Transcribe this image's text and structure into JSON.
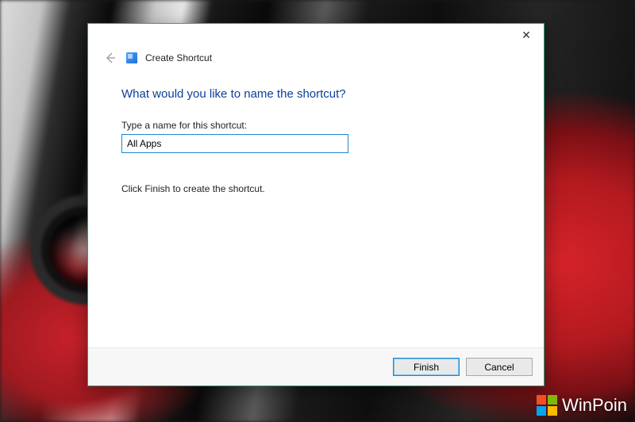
{
  "dialog": {
    "window_title": "Create Shortcut",
    "heading": "What would you like to name the shortcut?",
    "field_label": "Type a name for this shortcut:",
    "input_value": "All Apps",
    "hint": "Click Finish to create the shortcut.",
    "buttons": {
      "finish": "Finish",
      "cancel": "Cancel"
    },
    "close_glyph": "✕"
  },
  "watermark": {
    "text": "WinPoin"
  }
}
